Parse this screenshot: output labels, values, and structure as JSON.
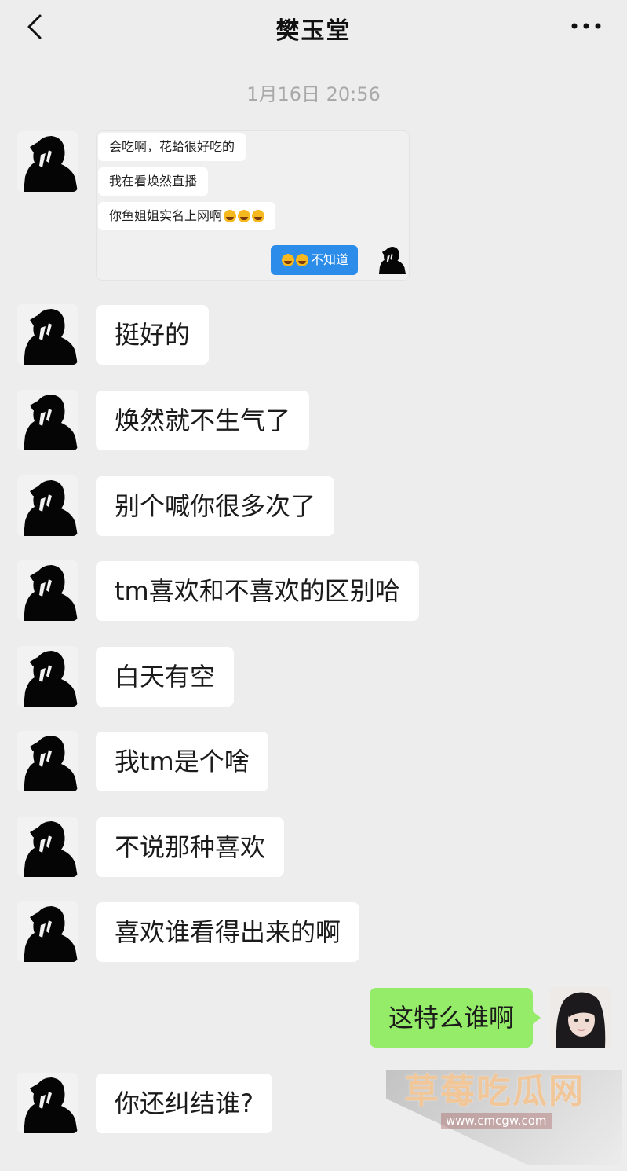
{
  "header": {
    "title": "樊玉堂",
    "back_icon": "chevron-left-icon",
    "more_icon": "ellipsis-icon"
  },
  "timestamp": "1月16日 20:56",
  "quoted_screenshot": {
    "messages": [
      "会吃啊，花蛤很好吃的",
      "我在看焕然直播",
      "你鱼姐姐实名上网啊"
    ],
    "reply": "不知道",
    "emoji_name": "rolling-laugh-emoji"
  },
  "messages": [
    {
      "from": "other",
      "text": "挺好的"
    },
    {
      "from": "other",
      "text": "焕然就不生气了"
    },
    {
      "from": "other",
      "text": "别个喊你很多次了"
    },
    {
      "from": "other",
      "text": "tm喜欢和不喜欢的区别哈"
    },
    {
      "from": "other",
      "text": "白天有空"
    },
    {
      "from": "other",
      "text": "我tm是个啥"
    },
    {
      "from": "other",
      "text": "不说那种喜欢"
    },
    {
      "from": "other",
      "text": "喜欢谁看得出来的啊"
    },
    {
      "from": "me",
      "text": "这特么谁啊"
    },
    {
      "from": "other",
      "text": "你还纠结谁?"
    }
  ],
  "watermark": {
    "text": "草莓吃瓜网",
    "url": "www.cmcgw.com"
  },
  "colors": {
    "background": "#ededed",
    "bubble_other": "#ffffff",
    "bubble_me": "#95ec69",
    "timestamp": "#a9a9a9",
    "blue_bubble": "#2b8de9"
  }
}
